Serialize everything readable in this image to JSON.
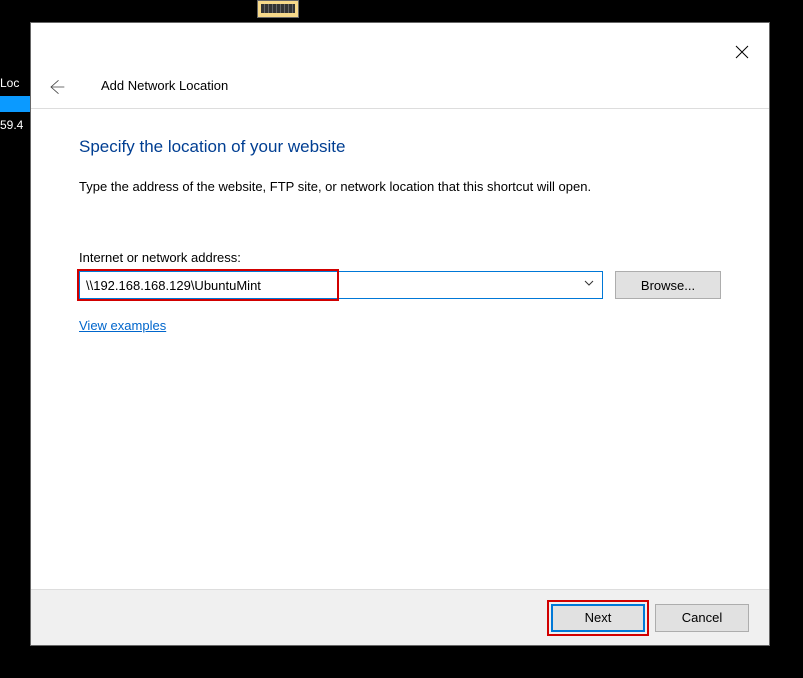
{
  "background": {
    "side_label_top": "Loc",
    "side_label_bottom": "59.4"
  },
  "dialog": {
    "title": "Add Network Location",
    "heading": "Specify the location of your website",
    "description": "Type the address of the website, FTP site, or network location that this shortcut will open.",
    "field_label": "Internet or network address:",
    "address_value": "\\\\192.168.168.129\\UbuntuMint",
    "browse_label": "Browse...",
    "examples_link": "View examples",
    "next_label": "Next",
    "cancel_label": "Cancel"
  }
}
